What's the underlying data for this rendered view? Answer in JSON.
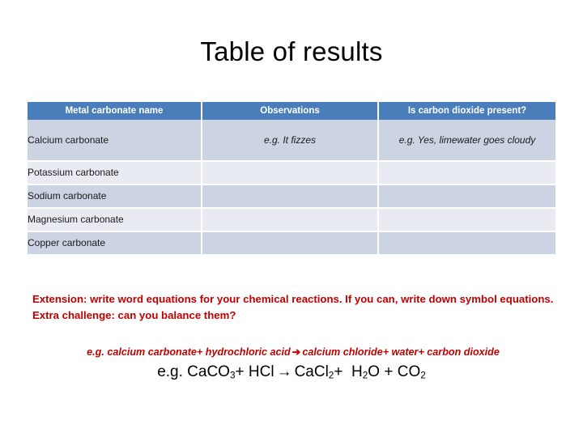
{
  "slide": {
    "title": "Table of results"
  },
  "table": {
    "headers": [
      "Metal carbonate name",
      "Observations",
      "Is carbon dioxide present?"
    ],
    "rows": [
      {
        "name": "Calcium carbonate",
        "observations": "e.g. It fizzes",
        "co2": "e.g. Yes, limewater goes cloudy"
      },
      {
        "name": "Potassium carbonate",
        "observations": "",
        "co2": ""
      },
      {
        "name": "Sodium carbonate",
        "observations": "",
        "co2": ""
      },
      {
        "name": "Magnesium carbonate",
        "observations": "",
        "co2": ""
      },
      {
        "name": "Copper carbonate",
        "observations": "",
        "co2": ""
      }
    ],
    "header_bg": "#4a7ebb",
    "header_text_color": "#ffffff",
    "row_dark_bg": "#ccd4e4",
    "row_light_bg": "#e8ebf2"
  },
  "extension": {
    "text": "Extension: write word equations for your chemical reactions. If you can, write down symbol equations. Extra challenge: can you balance them?",
    "color": "#c00000"
  },
  "word_equation": {
    "left": "e.g. calcium carbonate+ hydrochloric acid",
    "arrow": "➔",
    "right": "calcium chloride+ water+ carbon dioxide",
    "color": "#c00000"
  },
  "symbol_equation": {
    "prefix": "e.g. CaCO",
    "sub1": "3",
    "mid1": "+ HCl",
    "arrow": "→",
    "mid2": "CaCl",
    "sub2": "2",
    "mid3": "+",
    "mid4": "H",
    "sub3": "2",
    "mid5": "O",
    "mid6": "+",
    "mid7": "CO",
    "sub4": "2",
    "color": "#000000"
  }
}
